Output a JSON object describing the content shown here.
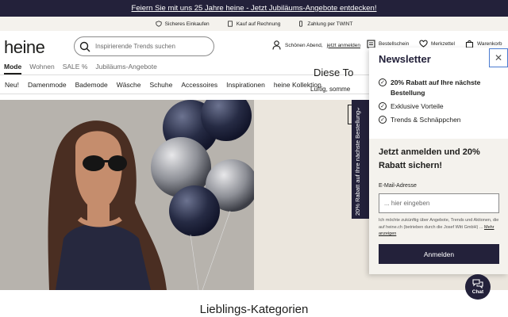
{
  "promo": {
    "text": "Feiern Sie mit uns 25 Jahre heine - Jetzt Jubiläums-Angebote entdecken!"
  },
  "trust": {
    "items": [
      "Sicheres Einkaufen",
      "Kauf auf Rechnung",
      "Zahlung per TWINT"
    ]
  },
  "header": {
    "logo": "heine",
    "search_placeholder": "Inspirierende Trends suchen",
    "greeting": "Schönen Abend,",
    "login": "jetzt anmelden",
    "order_label": "Bestellschein",
    "wishlist_label": "Merkzettel",
    "cart_label": "Warenkorb"
  },
  "nav_top": [
    "Mode",
    "Wohnen",
    "SALE %",
    "Jubiläums-Angebote"
  ],
  "nav_main": [
    "Neu!",
    "Damenmode",
    "Bademode",
    "Wäsche",
    "Schuhe",
    "Accessoires",
    "Inspirationen",
    "heine Kollektion"
  ],
  "hero": {
    "title": "Diese To",
    "subtitle": "Luftig, somme"
  },
  "side_tab": {
    "label": "20% Rabatt auf Ihre nächste Bestellung"
  },
  "section": {
    "title": "Lieblings-Kategorien"
  },
  "newsletter": {
    "title": "Newsletter",
    "benefits": [
      "20% Rabatt auf Ihre nächste Bestellung",
      "Exklusive Vorteile",
      "Trends & Schnäppchen"
    ],
    "headline": "Jetzt anmelden und 20% Rabatt sichern!",
    "email_label": "E-Mail-Adresse",
    "email_placeholder": "... hier eingeben",
    "legal": "Ich möchte zukünftig über Angebote, Trends und Aktionen, die auf heine.ch (betrieben durch die Josef Witt GmbH) ...",
    "more": "Mehr anzeigen",
    "submit": "Anmelden"
  },
  "chat": {
    "label": "Chat"
  },
  "colors": {
    "brand_dark": "#23213a",
    "beige": "#f4f2ed"
  }
}
